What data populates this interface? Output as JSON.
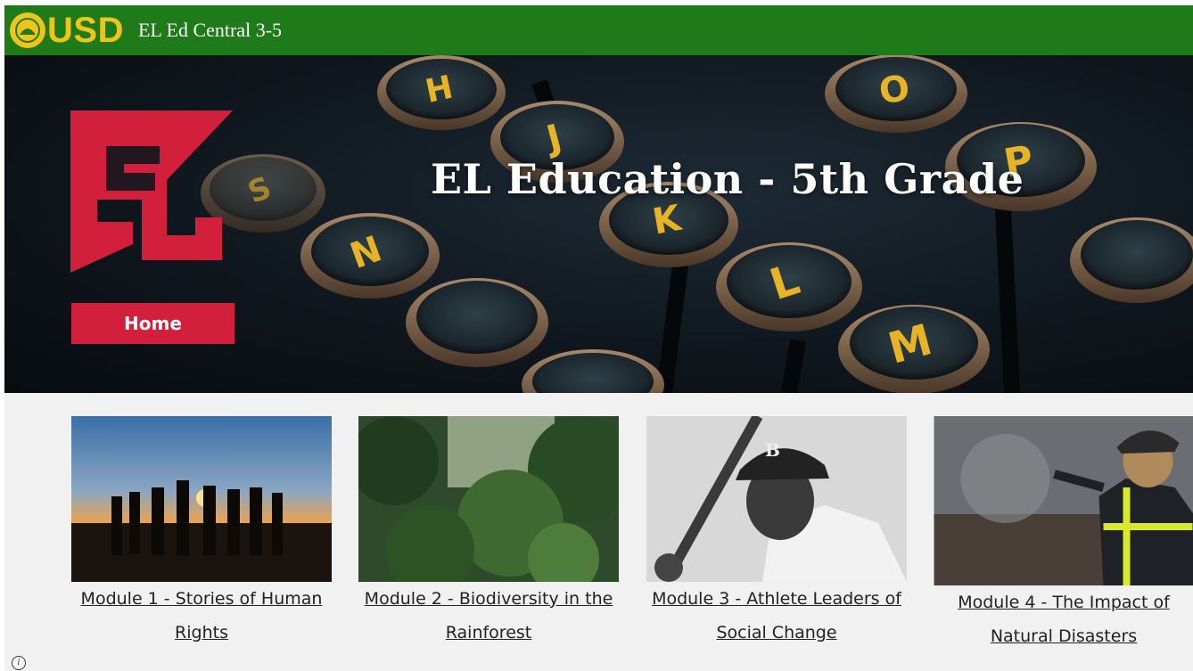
{
  "header": {
    "logo_text": "USD",
    "site_title": "EL Ed Central 3-5",
    "colors": {
      "bar": "#1f7a1a",
      "logo": "#f0c419"
    }
  },
  "hero": {
    "title": "EL Education - 5th Grade",
    "logo_text": "EL",
    "home_label": "Home",
    "accent": "#d21f3c",
    "keys": [
      "H",
      "J",
      "K",
      "L",
      "M",
      "N",
      "O",
      "P",
      "S"
    ]
  },
  "modules": [
    {
      "line1": "Module 1 - Stories of Human",
      "line2": "Rights",
      "image": "silhouettes-sunset-image"
    },
    {
      "line1": "Module 2 - Biodiversity in the",
      "line2": "Rainforest",
      "image": "rainforest-image"
    },
    {
      "line1": "Module 3 - Athlete Leaders of",
      "line2": "Social Change",
      "image": "baseball-player-image"
    },
    {
      "line1": "Module 4 - The Impact of",
      "line2": "Natural Disasters",
      "image": "firefighter-image"
    }
  ],
  "footer": {
    "info_icon": "info-icon"
  }
}
